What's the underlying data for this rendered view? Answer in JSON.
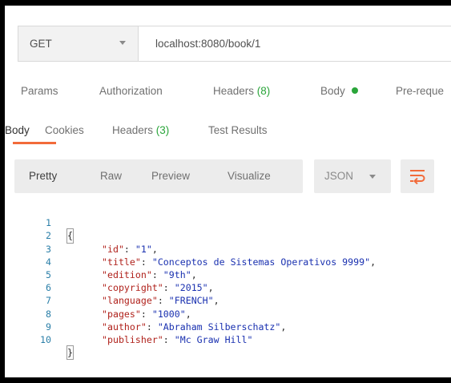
{
  "request": {
    "method": "GET",
    "url": "localhost:8080/book/1"
  },
  "request_tabs": [
    {
      "label": "Params",
      "count": ""
    },
    {
      "label": "Authorization",
      "count": ""
    },
    {
      "label": "Headers",
      "count": "(8)"
    },
    {
      "label": "Body",
      "count": ""
    },
    {
      "label": "Pre-reque",
      "count": ""
    }
  ],
  "response_tabs": [
    {
      "label": "Body",
      "count": ""
    },
    {
      "label": "Cookies",
      "count": ""
    },
    {
      "label": "Headers",
      "count": "(3)"
    },
    {
      "label": "Test Results",
      "count": ""
    }
  ],
  "view_modes": [
    "Pretty",
    "Raw",
    "Preview",
    "Visualize"
  ],
  "active_view": "Pretty",
  "format": "JSON",
  "colors": {
    "accent": "#f26b3a",
    "status_green": "#2aa53a",
    "json_key": "#b0221c",
    "json_string": "#1a31b0",
    "line_number": "#2b7fa8"
  },
  "response_body": {
    "line_numbers": [
      "1",
      "2",
      "3",
      "4",
      "5",
      "6",
      "7",
      "8",
      "9",
      "10"
    ],
    "open_brace": "{",
    "close_brace": "}",
    "fields": [
      {
        "key": "\"id\"",
        "value": "\"1\""
      },
      {
        "key": "\"title\"",
        "value": "\"Conceptos de Sistemas Operativos 9999\""
      },
      {
        "key": "\"edition\"",
        "value": "\"9th\""
      },
      {
        "key": "\"copyright\"",
        "value": "\"2015\""
      },
      {
        "key": "\"language\"",
        "value": "\"FRENCH\""
      },
      {
        "key": "\"pages\"",
        "value": "\"1000\""
      },
      {
        "key": "\"author\"",
        "value": "\"Abraham Silberschatz\""
      },
      {
        "key": "\"publisher\"",
        "value": "\"Mc Graw Hill\""
      }
    ]
  }
}
